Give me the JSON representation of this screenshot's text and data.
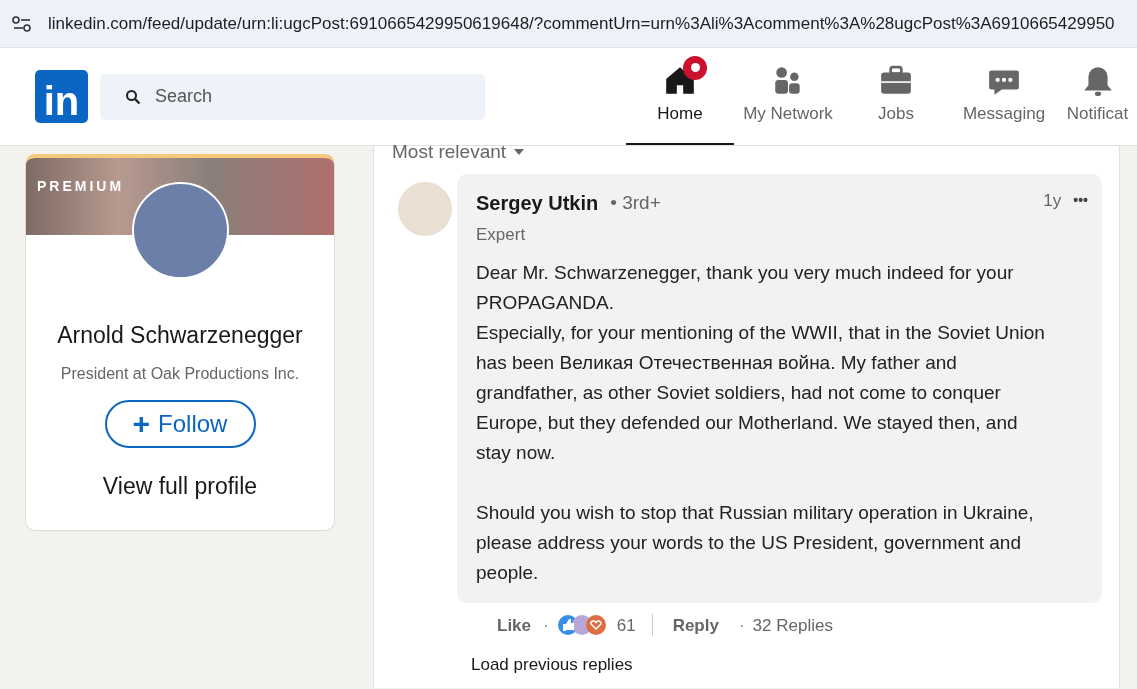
{
  "address_bar": {
    "url": "linkedin.com/feed/update/urn:li:ugcPost:6910665429950619648/?commentUrn=urn%3Ali%3Acomment%3A%28ugcPost%3A6910665429950"
  },
  "header": {
    "logo": "in",
    "search": {
      "placeholder": "Search"
    },
    "nav": [
      {
        "label": "Home",
        "kind": "home",
        "selected": true,
        "badge": true
      },
      {
        "label": "My Network",
        "kind": "network",
        "selected": false,
        "badge": false
      },
      {
        "label": "Jobs",
        "kind": "jobs",
        "selected": false,
        "badge": false
      },
      {
        "label": "Messaging",
        "kind": "messaging",
        "selected": false,
        "badge": false
      },
      {
        "label": "Notificat",
        "kind": "bell",
        "selected": false,
        "badge": false
      }
    ]
  },
  "profile_card": {
    "banner_label": "PREMIUM",
    "name": "Arnold Schwarzenegger",
    "headline": "President at Oak Productions Inc.",
    "follow": "Follow",
    "follow_icon": "+",
    "view_profile": "View full profile"
  },
  "sort": {
    "label": "Most relevant"
  },
  "comment": {
    "author": "Sergey Utkin",
    "degree": "• 3rd+",
    "headline": "Expert",
    "time": "1y",
    "more": "•••",
    "body": [
      [
        "Dear Mr. Schwarzenegger, thank you very much indeed for your PROPAGANDA.",
        "Especially, for your mentioning of the WWII, that in the Soviet Union has been Великая Отечественная война. My father and grandfather, as other Soviet soldiers, had not come to conquer Europe, but they defended our Motherland. We stayed then, and stay now."
      ],
      [
        "Should you wish to stop that Russian military operation in Ukraine, please address your words to the US President, government and people."
      ]
    ],
    "like": "Like",
    "separator_1": "·",
    "reactions_count": "61",
    "reply": "Reply",
    "separator_2": "·",
    "replies": "32 Replies"
  },
  "load_previous": "Load previous replies"
}
